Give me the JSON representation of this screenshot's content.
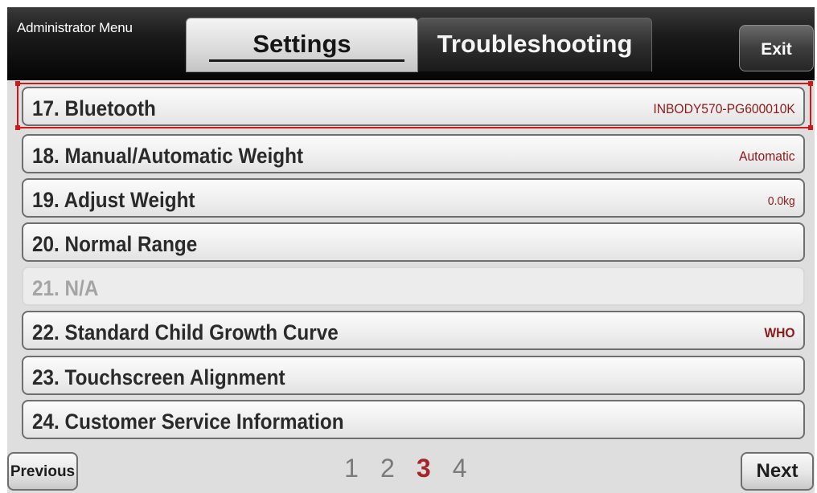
{
  "header": {
    "title": "Administrator Menu",
    "tabs": [
      {
        "label": "Settings",
        "active": true
      },
      {
        "label": "Troubleshooting",
        "active": false
      }
    ],
    "exit_label": "Exit"
  },
  "items": [
    {
      "label": "17. Bluetooth",
      "value": "INBODY570-PG600010K",
      "enabled": true,
      "selected": true
    },
    {
      "label": "18. Manual/Automatic Weight",
      "value": "Automatic",
      "enabled": true
    },
    {
      "label": "19. Adjust Weight",
      "value": "0.0kg",
      "enabled": true
    },
    {
      "label": "20. Normal Range",
      "value": "",
      "enabled": true
    },
    {
      "label": "21. N/A",
      "value": "",
      "enabled": false
    },
    {
      "label": "22. Standard Child Growth Curve",
      "value": "WHO",
      "enabled": true
    },
    {
      "label": "23. Touchscreen Alignment",
      "value": "",
      "enabled": true
    },
    {
      "label": "24. Customer Service Information",
      "value": "",
      "enabled": true
    }
  ],
  "footer": {
    "previous_label": "Previous",
    "next_label": "Next",
    "pages": [
      "1",
      "2",
      "3",
      "4"
    ],
    "current_page": "3"
  },
  "colors": {
    "value_text": "#8b1a1a",
    "current_page": "#a5262a",
    "selection_outline": "#d01818"
  }
}
